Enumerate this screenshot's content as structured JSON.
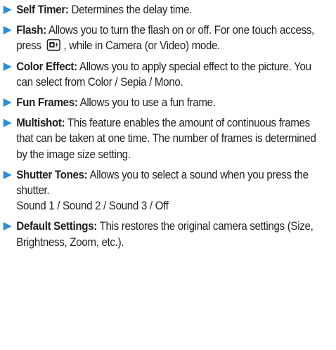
{
  "items": [
    {
      "term": "Self Timer:",
      "text": " Determines the delay time."
    },
    {
      "term": "Flash:",
      "text_before_icon": " Allows you to turn the flash on or off.  For one touch access, press ",
      "icon": "flash-key-icon",
      "text_after_icon": ", while in Camera (or Video) mode."
    },
    {
      "term": "Color Effect:",
      "text": " Allows you to apply special effect to the picture. You can select from Color / Sepia / Mono."
    },
    {
      "term": "Fun Frames:",
      "text": " Allows you to use a fun frame."
    },
    {
      "term": "Multishot:",
      "text": " This feature enables the amount of continuous frames that can be taken at one time. The number of frames is determined by the image size setting."
    },
    {
      "term": "Shutter Tones:",
      "text": " Allows you to select a sound when you press the shutter.",
      "options": "Sound 1 / Sound 2 / Sound 3 / Off"
    },
    {
      "term": "Default Settings:",
      "text": " This restores the original camera settings (Size, Brightness, Zoom, etc.)."
    }
  ],
  "colors": {
    "bullet": "#2c8fd6",
    "text": "#231f20"
  }
}
